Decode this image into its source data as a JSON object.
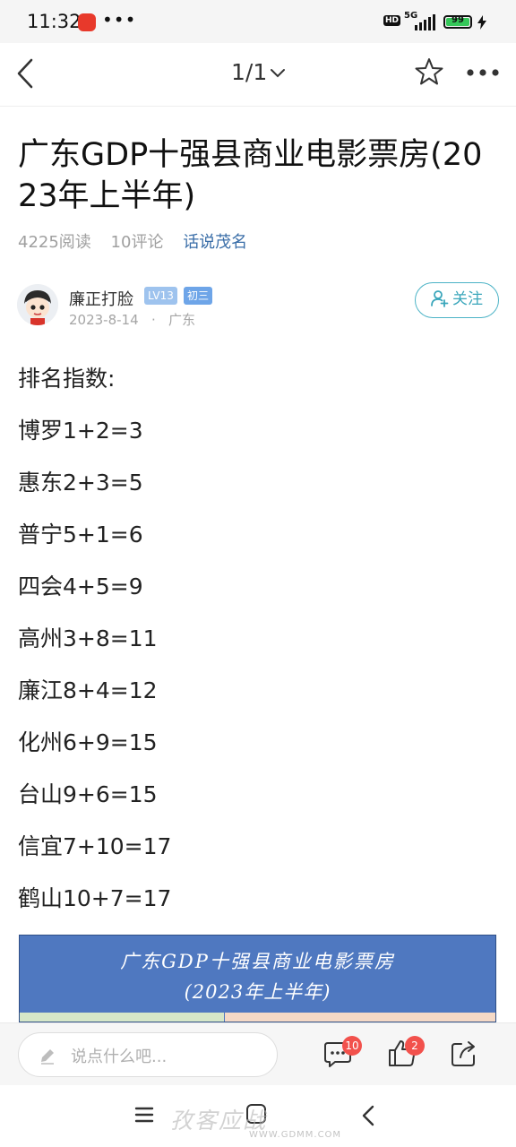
{
  "status_bar": {
    "time": "11:32",
    "dots": "•••",
    "hd": "HD",
    "network": "5G",
    "battery": 99
  },
  "nav": {
    "page_indicator": "1/1"
  },
  "article": {
    "title": "广东GDP十强县商业电影票房(2023年上半年)",
    "reads": "4225阅读",
    "comments": "10评论",
    "topic": "话说茂名",
    "author": {
      "name": "廉正打脸",
      "level_badge": "LV13",
      "grade_badge": "初三",
      "date": "2023-8-14",
      "separator": "·",
      "location": "广东"
    },
    "follow_label": "关注",
    "lines": [
      "排名指数:",
      "博罗1+2=3",
      "惠东2+3=5",
      "普宁5+1=6",
      "四会4+5=9",
      "高州3+8=11",
      "廉江8+4=12",
      "化州6+9=15",
      "台山9+6=15",
      "信宜7+10=17",
      "鹤山10+7=17"
    ],
    "image": {
      "title_line1": "广东GDP十强县商业电影票房",
      "title_line2": "(2023年上半年)"
    }
  },
  "bottom_bar": {
    "comment_placeholder": "说点什么吧...",
    "comment_count": "10",
    "like_count": "2"
  },
  "watermark": {
    "text": "孜客应战",
    "url": "WWW.GDMM.COM"
  },
  "colors": {
    "accent_topic": "#3a6ea8",
    "follow": "#3aa6bb",
    "badge_red": "#f2514c",
    "image_header": "#4f78c0"
  }
}
